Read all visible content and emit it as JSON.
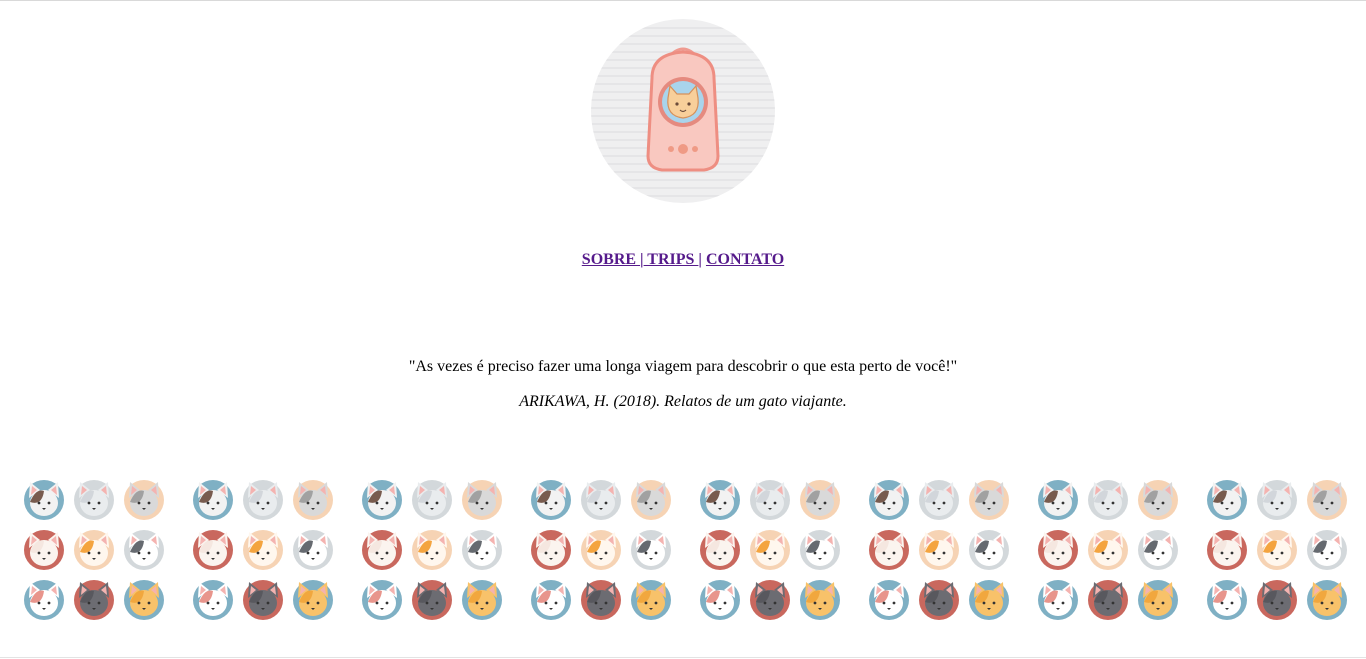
{
  "logo": {
    "icon": "cat-in-backpack-logo"
  },
  "nav": {
    "sobre_label": "SOBRE ",
    "sep1": "|",
    "trips_label": " TRIPS ",
    "sep2": "|",
    "contato_label": "CONTATO"
  },
  "quote": {
    "text": "\"As vezes é preciso fazer uma longa viagem para descobrir o que esta perto de você!\"",
    "citation": "ARIKAWA, H. (2018). Relatos de um gato viajante."
  },
  "pattern": {
    "icon": "cat-faces-pattern",
    "colors": {
      "blue": "#7fb0c4",
      "grey": "#d3d8db",
      "peach": "#f6d3b4",
      "red": "#c9685e",
      "pink": "#f7c6bf"
    }
  }
}
